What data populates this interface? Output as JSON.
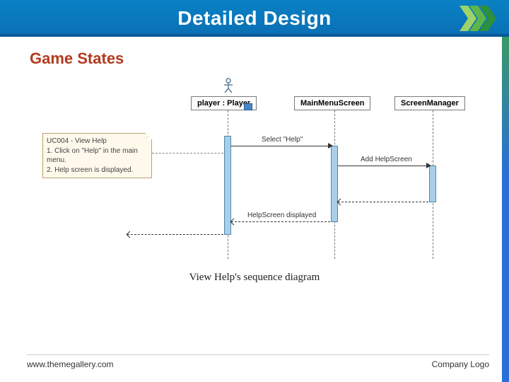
{
  "header": {
    "title": "Detailed Design"
  },
  "section": {
    "title": "Game States"
  },
  "diagram": {
    "lifelines": {
      "player": "player : Player",
      "menu": "MainMenuScreen",
      "manager": "ScreenManager"
    },
    "note": {
      "title": "UC004 - View Help",
      "line1": "1. Click on \"Help\" in the main menu.",
      "line2": "2. Help screen is displayed."
    },
    "messages": {
      "select_help": "Select \"Help\"",
      "add_help": "Add HelpScreen",
      "help_displayed": "HelpScreen displayed"
    },
    "caption": "View Help's sequence diagram"
  },
  "footer": {
    "url": "www.themegallery.com",
    "logo": "Company Logo"
  }
}
